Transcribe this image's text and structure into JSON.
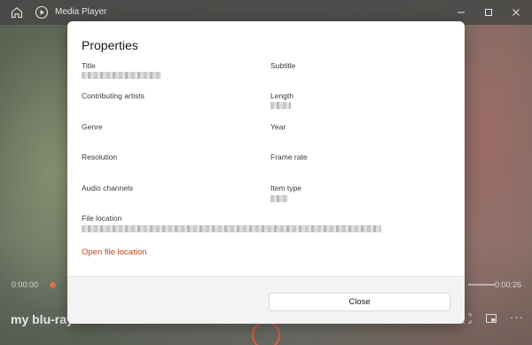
{
  "window": {
    "title": "Media Player",
    "icons": {
      "home": "home-icon",
      "app": "play-circle-icon",
      "minimize": "minimize-icon",
      "maximize": "maximize-icon",
      "close": "close-icon"
    }
  },
  "player": {
    "current_time": "0:00:00",
    "duration": "0:00:26",
    "media_title": "my blu-ray",
    "accent_color": "#e05a3e"
  },
  "dialog": {
    "title": "Properties",
    "fields": {
      "title": {
        "label": "Title",
        "value_visible": false
      },
      "subtitle": {
        "label": "Subtitle"
      },
      "contributing_artists": {
        "label": "Contributing artists"
      },
      "length": {
        "label": "Length",
        "value_visible": false
      },
      "genre": {
        "label": "Genre"
      },
      "year": {
        "label": "Year"
      },
      "resolution": {
        "label": "Resolution"
      },
      "frame_rate": {
        "label": "Frame rate"
      },
      "audio_channels": {
        "label": "Audio channels"
      },
      "item_type": {
        "label": "Item type",
        "value_visible": false
      },
      "file_location": {
        "label": "File location",
        "value_visible": false
      }
    },
    "open_file_location": "Open file location",
    "close_button": "Close",
    "link_color": "#c4421c"
  }
}
